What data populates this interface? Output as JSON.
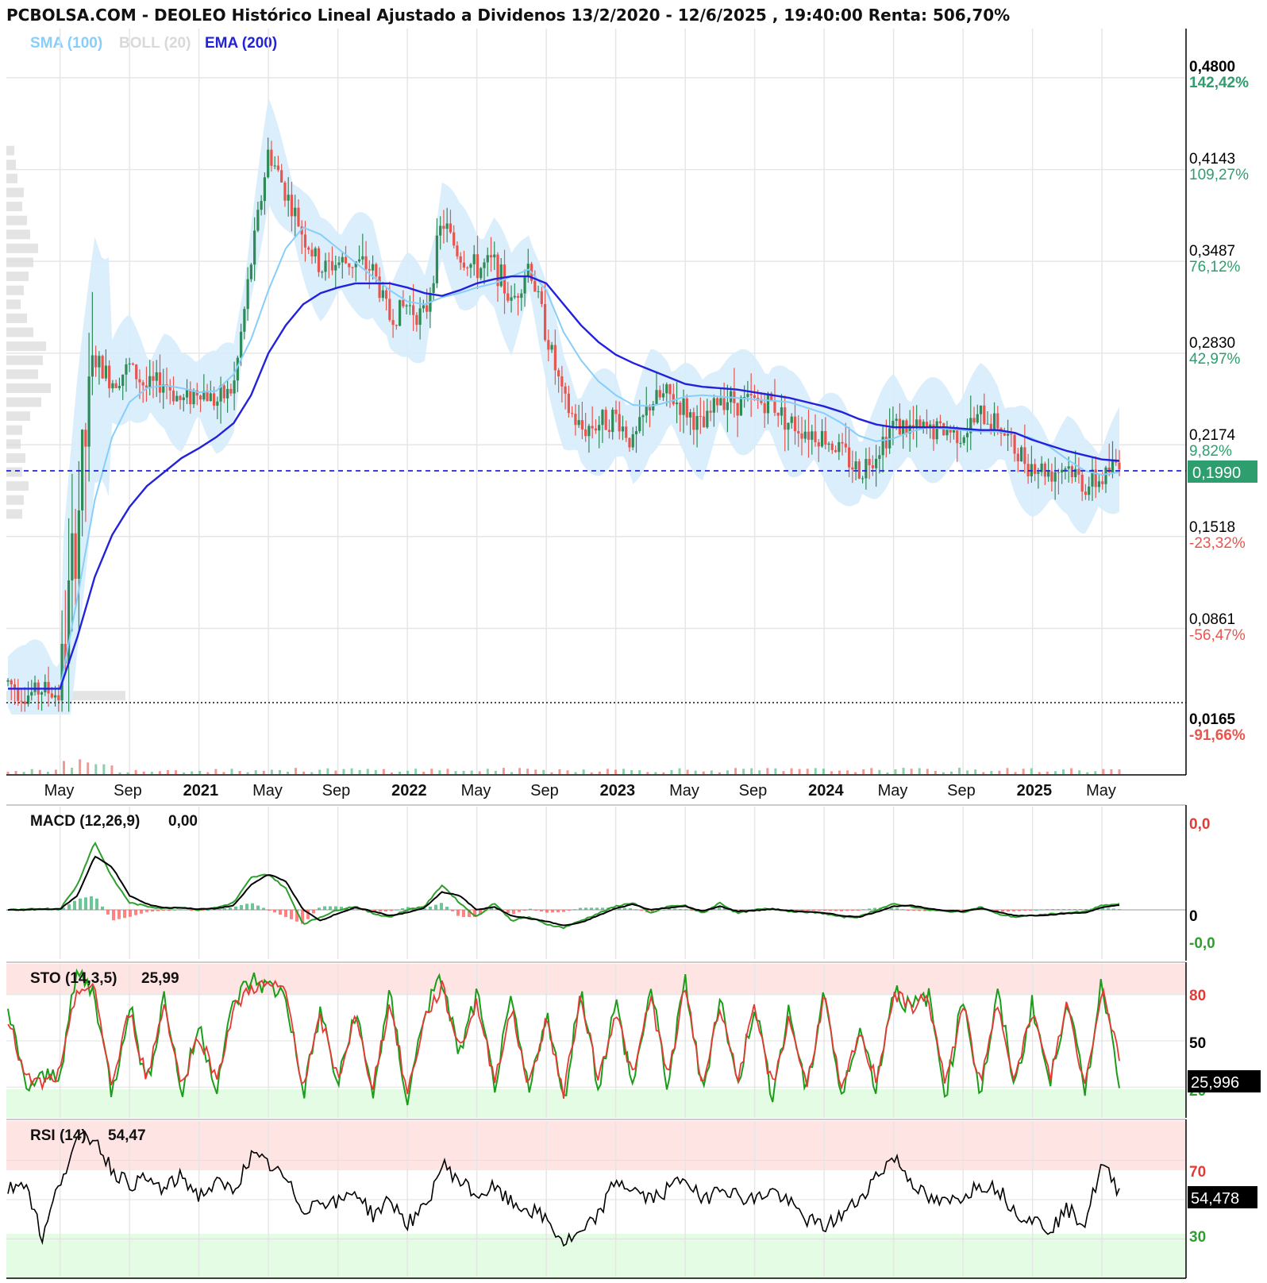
{
  "header": {
    "title": "PCBOLSA.COM - DEOLEO Histórico Lineal Ajustado a Dividenos 13/2/2020 - 12/6/2025 , 19:40:00 Renta: 506,70%"
  },
  "legend": {
    "sma": "SMA (100)",
    "boll": "BOLL (20)",
    "ema": "EMA (200)"
  },
  "colors": {
    "up": "#2e8b57",
    "down": "#e8554e",
    "sma": "#87cefa",
    "boll_fill": "#d7ecfb",
    "ema": "#2222dd",
    "current_badge": "#2e9e6e",
    "pct_up": "#2e9e6e",
    "pct_down": "#e8554e"
  },
  "price_axis": {
    "labels": [
      {
        "value": "0,4800",
        "pct": "142,42%",
        "dir": "up",
        "bold": true
      },
      {
        "value": "0,4143",
        "pct": "109,27%",
        "dir": "up",
        "bold": false
      },
      {
        "value": "0,3487",
        "pct": "76,12%",
        "dir": "up",
        "bold": false
      },
      {
        "value": "0,2830",
        "pct": "42,97%",
        "dir": "up",
        "bold": false
      },
      {
        "value": "0,2174",
        "pct": "9,82%",
        "dir": "up",
        "bold": false
      },
      {
        "value": "0,1518",
        "pct": "-23,32%",
        "dir": "down",
        "bold": false
      },
      {
        "value": "0,0861",
        "pct": "-56,47%",
        "dir": "down",
        "bold": false
      },
      {
        "value": "0,0165",
        "pct": "-91,66%",
        "dir": "down",
        "bold": true
      }
    ],
    "current": "0,1990"
  },
  "x_axis": {
    "labels": [
      {
        "text": "May",
        "year": false
      },
      {
        "text": "Sep",
        "year": false
      },
      {
        "text": "2021",
        "year": true
      },
      {
        "text": "May",
        "year": false
      },
      {
        "text": "Sep",
        "year": false
      },
      {
        "text": "2022",
        "year": true
      },
      {
        "text": "May",
        "year": false
      },
      {
        "text": "Sep",
        "year": false
      },
      {
        "text": "2023",
        "year": true
      },
      {
        "text": "May",
        "year": false
      },
      {
        "text": "Sep",
        "year": false
      },
      {
        "text": "2024",
        "year": true
      },
      {
        "text": "May",
        "year": false
      },
      {
        "text": "Sep",
        "year": false
      },
      {
        "text": "2025",
        "year": true
      },
      {
        "text": "May",
        "year": false
      }
    ]
  },
  "chart_data": [
    {
      "type": "line",
      "panel": "price",
      "ylim": [
        0.0165,
        0.48
      ],
      "x": [
        "2020-02",
        "2020-03",
        "2020-04",
        "2020-05",
        "2020-06",
        "2020-07",
        "2020-08",
        "2020-09",
        "2020-10",
        "2020-11",
        "2020-12",
        "2021-01",
        "2021-02",
        "2021-03",
        "2021-04",
        "2021-05",
        "2021-06",
        "2021-07",
        "2021-08",
        "2021-09",
        "2021-10",
        "2021-11",
        "2021-12",
        "2022-01",
        "2022-02",
        "2022-03",
        "2022-04",
        "2022-05",
        "2022-06",
        "2022-07",
        "2022-08",
        "2022-09",
        "2022-10",
        "2022-11",
        "2022-12",
        "2023-01",
        "2023-02",
        "2023-03",
        "2023-04",
        "2023-05",
        "2023-06",
        "2023-07",
        "2023-08",
        "2023-09",
        "2023-10",
        "2023-11",
        "2023-12",
        "2024-01",
        "2024-02",
        "2024-03",
        "2024-04",
        "2024-05",
        "2024-06",
        "2024-07",
        "2024-08",
        "2024-09",
        "2024-10",
        "2024-11",
        "2024-12",
        "2025-01",
        "2025-02",
        "2025-03",
        "2025-04",
        "2025-05",
        "2025-06"
      ],
      "series": [
        {
          "name": "EMA (200)",
          "values": [
            0.035,
            0.035,
            0.035,
            0.035,
            0.072,
            0.115,
            0.145,
            0.165,
            0.18,
            0.19,
            0.2,
            0.207,
            0.215,
            0.225,
            0.245,
            0.275,
            0.295,
            0.31,
            0.318,
            0.322,
            0.325,
            0.325,
            0.325,
            0.322,
            0.318,
            0.316,
            0.32,
            0.325,
            0.328,
            0.33,
            0.33,
            0.325,
            0.31,
            0.295,
            0.283,
            0.274,
            0.268,
            0.263,
            0.258,
            0.253,
            0.251,
            0.25,
            0.249,
            0.247,
            0.245,
            0.243,
            0.24,
            0.237,
            0.233,
            0.228,
            0.224,
            0.222,
            0.222,
            0.222,
            0.222,
            0.221,
            0.22,
            0.22,
            0.218,
            0.213,
            0.209,
            0.205,
            0.202,
            0.199,
            0.198
          ]
        },
        {
          "name": "SMA (100)",
          "values": [
            0.035,
            0.035,
            0.035,
            0.035,
            0.1,
            0.17,
            0.215,
            0.24,
            0.25,
            0.252,
            0.25,
            0.247,
            0.248,
            0.26,
            0.285,
            0.32,
            0.35,
            0.365,
            0.36,
            0.35,
            0.34,
            0.33,
            0.32,
            0.312,
            0.31,
            0.315,
            0.318,
            0.322,
            0.325,
            0.33,
            0.335,
            0.32,
            0.29,
            0.27,
            0.255,
            0.245,
            0.238,
            0.237,
            0.24,
            0.244,
            0.245,
            0.244,
            0.243,
            0.242,
            0.241,
            0.24,
            0.236,
            0.232,
            0.225,
            0.216,
            0.212,
            0.214,
            0.219,
            0.222,
            0.221,
            0.22,
            0.219,
            0.219,
            0.218,
            0.214,
            0.208,
            0.199,
            0.191,
            0.188,
            0.19
          ]
        },
        {
          "name": "Precio",
          "values": [
            0.04,
            0.03,
            0.035,
            0.03,
            0.16,
            0.27,
            0.255,
            0.265,
            0.25,
            0.255,
            0.24,
            0.25,
            0.24,
            0.25,
            0.34,
            0.42,
            0.39,
            0.36,
            0.335,
            0.34,
            0.34,
            0.335,
            0.3,
            0.31,
            0.3,
            0.37,
            0.345,
            0.335,
            0.34,
            0.31,
            0.34,
            0.29,
            0.24,
            0.22,
            0.225,
            0.23,
            0.21,
            0.24,
            0.245,
            0.235,
            0.22,
            0.245,
            0.24,
            0.24,
            0.24,
            0.225,
            0.22,
            0.215,
            0.205,
            0.19,
            0.205,
            0.225,
            0.22,
            0.22,
            0.22,
            0.218,
            0.23,
            0.225,
            0.205,
            0.195,
            0.19,
            0.195,
            0.18,
            0.185,
            0.199
          ]
        }
      ]
    },
    {
      "type": "line",
      "panel": "macd",
      "title": "MACD (12,26,9)",
      "value": "0,00",
      "y_labels": {
        "top": "0,0",
        "zero": "0",
        "bottom": "-0,0"
      },
      "x": [
        "2020-02",
        "2020-03",
        "2020-04",
        "2020-05",
        "2020-06",
        "2020-07",
        "2020-08",
        "2020-09",
        "2020-10",
        "2020-11",
        "2020-12",
        "2021-01",
        "2021-02",
        "2021-03",
        "2021-04",
        "2021-05",
        "2021-06",
        "2021-07",
        "2021-08",
        "2021-09",
        "2021-10",
        "2021-11",
        "2021-12",
        "2022-01",
        "2022-02",
        "2022-03",
        "2022-04",
        "2022-05",
        "2022-06",
        "2022-07",
        "2022-08",
        "2022-09",
        "2022-10",
        "2022-11",
        "2022-12",
        "2023-01",
        "2023-02",
        "2023-03",
        "2023-04",
        "2023-05",
        "2023-06",
        "2023-07",
        "2023-08",
        "2023-09",
        "2023-10",
        "2023-11",
        "2023-12",
        "2024-01",
        "2024-02",
        "2024-03",
        "2024-04",
        "2024-05",
        "2024-06",
        "2024-07",
        "2024-08",
        "2024-09",
        "2024-10",
        "2024-11",
        "2024-12",
        "2025-01",
        "2025-02",
        "2025-03",
        "2025-04",
        "2025-05",
        "2025-06"
      ],
      "series": [
        {
          "name": "MACD",
          "values": [
            0,
            0,
            0.002,
            0.001,
            0.035,
            0.095,
            0.045,
            0.01,
            0.005,
            0.002,
            0.004,
            0,
            0.003,
            0.01,
            0.045,
            0.05,
            0.03,
            -0.02,
            -0.01,
            0,
            0.005,
            -0.005,
            -0.01,
            0,
            0.005,
            0.035,
            0.01,
            -0.01,
            0.01,
            -0.015,
            -0.01,
            -0.02,
            -0.025,
            -0.015,
            -0.005,
            0.005,
            0.01,
            -0.005,
            0.005,
            0.006,
            -0.005,
            0.01,
            -0.005,
            0,
            0.002,
            -0.002,
            -0.003,
            -0.005,
            -0.01,
            -0.01,
            0,
            0.008,
            0.005,
            0,
            -0.002,
            -0.003,
            0.004,
            -0.006,
            -0.01,
            -0.008,
            -0.006,
            -0.004,
            -0.003,
            0.006,
            0.008
          ]
        },
        {
          "name": "Señal",
          "values": [
            0,
            0,
            0.001,
            0.001,
            0.02,
            0.075,
            0.06,
            0.02,
            0.008,
            0.003,
            0.003,
            0.001,
            0.002,
            0.006,
            0.035,
            0.05,
            0.04,
            0,
            -0.015,
            -0.005,
            0.003,
            -0.002,
            -0.008,
            -0.004,
            0.003,
            0.025,
            0.02,
            0,
            0.004,
            -0.008,
            -0.012,
            -0.016,
            -0.022,
            -0.018,
            -0.008,
            0.002,
            0.008,
            0,
            0.003,
            0.005,
            -0.002,
            0.005,
            -0.002,
            -0.001,
            0.001,
            -0.001,
            -0.003,
            -0.004,
            -0.008,
            -0.01,
            -0.003,
            0.005,
            0.006,
            0.002,
            -0.001,
            -0.002,
            0.002,
            -0.003,
            -0.008,
            -0.008,
            -0.007,
            -0.005,
            -0.004,
            0.003,
            0.007
          ]
        }
      ]
    },
    {
      "type": "line",
      "panel": "sto",
      "title": "STO (14,3,5)",
      "value": "25,99",
      "current": "25,996",
      "levels": [
        "80",
        "50",
        "20"
      ],
      "ylim": [
        0,
        100
      ],
      "x": [
        "2020-02",
        "2020-03",
        "2020-04",
        "2020-05",
        "2020-06",
        "2020-07",
        "2020-08",
        "2020-09",
        "2020-10",
        "2020-11",
        "2020-12",
        "2021-01",
        "2021-02",
        "2021-03",
        "2021-04",
        "2021-05",
        "2021-06",
        "2021-07",
        "2021-08",
        "2021-09",
        "2021-10",
        "2021-11",
        "2021-12",
        "2022-01",
        "2022-02",
        "2022-03",
        "2022-04",
        "2022-05",
        "2022-06",
        "2022-07",
        "2022-08",
        "2022-09",
        "2022-10",
        "2022-11",
        "2022-12",
        "2023-01",
        "2023-02",
        "2023-03",
        "2023-04",
        "2023-05",
        "2023-06",
        "2023-07",
        "2023-08",
        "2023-09",
        "2023-10",
        "2023-11",
        "2023-12",
        "2024-01",
        "2024-02",
        "2024-03",
        "2024-04",
        "2024-05",
        "2024-06",
        "2024-07",
        "2024-08",
        "2024-09",
        "2024-10",
        "2024-11",
        "2024-12",
        "2025-01",
        "2025-02",
        "2025-03",
        "2025-04",
        "2025-05",
        "2025-06"
      ],
      "series": [
        {
          "name": "%K",
          "values": [
            70,
            20,
            25,
            30,
            95,
            80,
            15,
            75,
            20,
            80,
            15,
            60,
            20,
            75,
            90,
            85,
            80,
            15,
            70,
            20,
            70,
            15,
            80,
            10,
            70,
            90,
            40,
            80,
            20,
            75,
            15,
            70,
            10,
            85,
            20,
            75,
            20,
            85,
            20,
            90,
            15,
            80,
            20,
            75,
            15,
            70,
            15,
            85,
            10,
            60,
            20,
            85,
            70,
            80,
            15,
            80,
            15,
            80,
            20,
            75,
            20,
            80,
            15,
            90,
            26
          ]
        },
        {
          "name": "%D",
          "values": [
            65,
            25,
            22,
            28,
            85,
            82,
            20,
            70,
            25,
            75,
            20,
            55,
            25,
            70,
            85,
            86,
            82,
            20,
            65,
            25,
            65,
            20,
            75,
            15,
            65,
            85,
            45,
            75,
            25,
            70,
            20,
            65,
            15,
            80,
            25,
            70,
            25,
            80,
            25,
            85,
            20,
            75,
            25,
            70,
            20,
            65,
            20,
            80,
            15,
            55,
            25,
            80,
            72,
            78,
            20,
            75,
            20,
            75,
            25,
            70,
            25,
            75,
            20,
            85,
            40
          ]
        }
      ]
    },
    {
      "type": "line",
      "panel": "rsi",
      "title": "RSI (14)",
      "value": "54,47",
      "current": "54,478",
      "levels": [
        "70",
        "50",
        "30"
      ],
      "ylim": [
        10,
        90
      ],
      "x": [
        "2020-02",
        "2020-03",
        "2020-04",
        "2020-05",
        "2020-06",
        "2020-07",
        "2020-08",
        "2020-09",
        "2020-10",
        "2020-11",
        "2020-12",
        "2021-01",
        "2021-02",
        "2021-03",
        "2021-04",
        "2021-05",
        "2021-06",
        "2021-07",
        "2021-08",
        "2021-09",
        "2021-10",
        "2021-11",
        "2021-12",
        "2022-01",
        "2022-02",
        "2022-03",
        "2022-04",
        "2022-05",
        "2022-06",
        "2022-07",
        "2022-08",
        "2022-09",
        "2022-10",
        "2022-11",
        "2022-12",
        "2023-01",
        "2023-02",
        "2023-03",
        "2023-04",
        "2023-05",
        "2023-06",
        "2023-07",
        "2023-08",
        "2023-09",
        "2023-10",
        "2023-11",
        "2023-12",
        "2024-01",
        "2024-02",
        "2024-03",
        "2024-04",
        "2024-05",
        "2024-06",
        "2024-07",
        "2024-08",
        "2024-09",
        "2024-10",
        "2024-11",
        "2024-12",
        "2025-01",
        "2025-02",
        "2025-03",
        "2025-04",
        "2025-05",
        "2025-06"
      ],
      "series": [
        {
          "name": "RSI",
          "values": [
            55,
            60,
            30,
            60,
            80,
            82,
            65,
            58,
            60,
            55,
            62,
            52,
            58,
            55,
            72,
            68,
            60,
            45,
            50,
            48,
            55,
            42,
            50,
            38,
            45,
            68,
            60,
            52,
            56,
            48,
            45,
            40,
            28,
            32,
            42,
            60,
            55,
            50,
            55,
            62,
            48,
            58,
            52,
            50,
            55,
            48,
            40,
            36,
            42,
            50,
            62,
            72,
            60,
            50,
            48,
            52,
            58,
            56,
            44,
            40,
            35,
            45,
            38,
            68,
            54
          ]
        }
      ]
    }
  ]
}
